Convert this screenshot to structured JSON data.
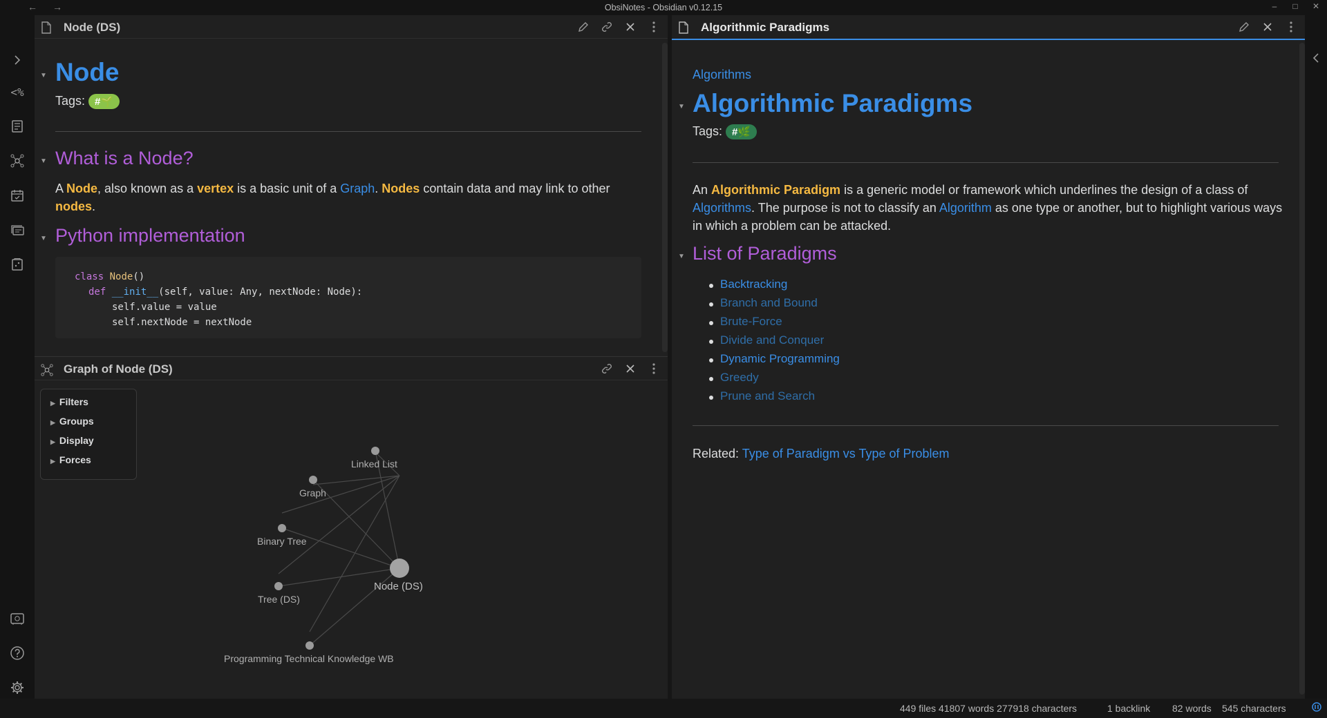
{
  "window": {
    "title": "ObsiNotes - Obsidian v0.12.15",
    "back": "←",
    "forward": "→",
    "minimize": "–",
    "maximize": "□",
    "close": "✕"
  },
  "left_pane": {
    "header_title": "Node (DS)",
    "h1": "Node",
    "tags_label": "Tags:",
    "tag_text": "#🌱",
    "tag_color": "#8bc34a",
    "section1_heading": "What is a Node?",
    "p": {
      "t1": "A ",
      "node": "Node",
      "t2": ", also known as a ",
      "vertex": "vertex",
      "t3": " is a basic unit of a ",
      "graph": "Graph",
      "t4": ". ",
      "nodes": "Nodes",
      "t5": " contain data and may link to other ",
      "nodes2": "nodes",
      "t6": "."
    },
    "section2_heading": "Python implementation",
    "code": {
      "l1_kw": "class",
      "l1_cls": "Node",
      "l1_rest": "()",
      "l2_kw": "def",
      "l2_fn": "__init__",
      "l2_rest": "(self, value: Any, nextNode: Node):",
      "l3": "self.value = value",
      "l4": "self.nextNode = nextNode"
    }
  },
  "graph_pane": {
    "header_title": "Graph of Node (DS)",
    "controls": [
      "Filters",
      "Groups",
      "Display",
      "Forces"
    ],
    "nodes": {
      "linked_list": "Linked List",
      "graph": "Graph",
      "binary_tree": "Binary Tree",
      "node_ds": "Node (DS)",
      "tree_ds": "Tree (DS)",
      "prog_wb": "Programming Technical Knowledge WB"
    }
  },
  "right_pane": {
    "header_title": "Algorithmic Paradigms",
    "breadcrumb": "Algorithms",
    "h1": "Algorithmic Paradigms",
    "tags_label": "Tags:",
    "tag_text": "#🌿",
    "tag_color": "#2e7d4f",
    "p": {
      "t1": "An ",
      "ap": "Algorithmic Paradigm",
      "t2": " is a generic model or framework which underlines the design of a class of ",
      "algorithms": "Algorithms",
      "t3": ". The purpose is not to classify an ",
      "algorithm": "Algorithm",
      "t4": " as one type or another, but to highlight various ways in which a problem can be attacked."
    },
    "section_heading": "List of Paradigms",
    "paradigms": [
      {
        "label": "Backtracking",
        "resolved": true
      },
      {
        "label": "Branch and Bound",
        "resolved": false
      },
      {
        "label": "Brute-Force",
        "resolved": false
      },
      {
        "label": "Divide and Conquer",
        "resolved": false
      },
      {
        "label": "Dynamic Programming",
        "resolved": true
      },
      {
        "label": "Greedy",
        "resolved": false
      },
      {
        "label": "Prune and Search",
        "resolved": false
      }
    ],
    "related_label": "Related:",
    "related_link": "Type of Paradigm vs Type of Problem"
  },
  "status": {
    "vault": "449 files 41807 words 277918 characters",
    "backlinks": "1 backlink",
    "note": "82 words",
    "chars": "545 characters"
  }
}
